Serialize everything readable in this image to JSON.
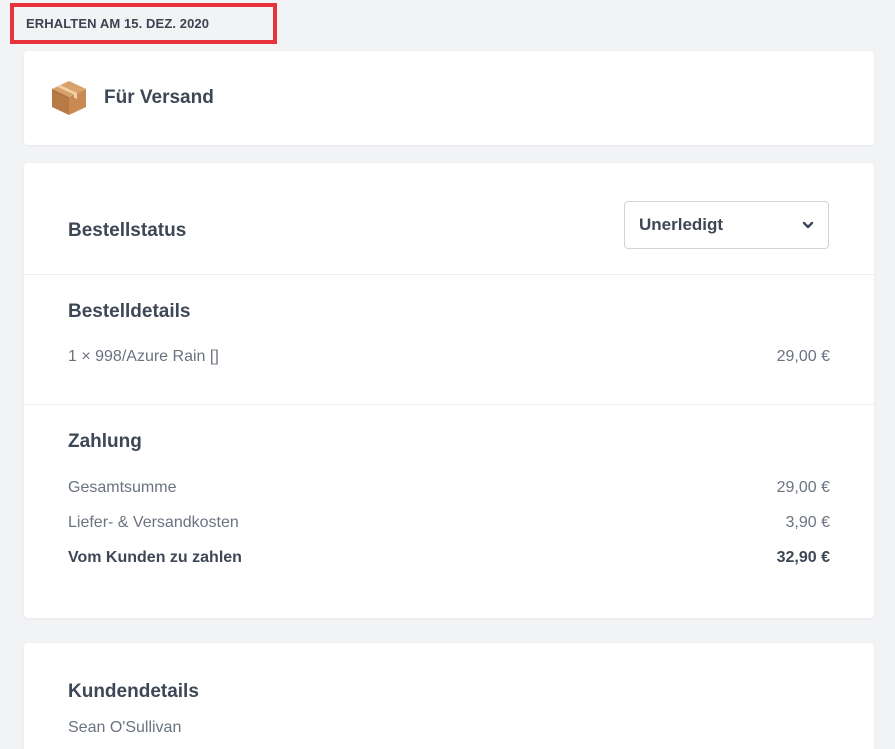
{
  "header": {
    "received_date": "ERHALTEN AM 15. DEZ. 2020"
  },
  "shipping": {
    "icon": "package-box-icon",
    "label": "Für Versand"
  },
  "order_status": {
    "title": "Bestellstatus",
    "selected": "Unerledigt",
    "chevron_icon": "chevron-down-icon"
  },
  "order_details": {
    "title": "Bestelldetails",
    "items": [
      {
        "description": "1 × 998/Azure Rain []",
        "price": "29,00 €"
      }
    ]
  },
  "payment": {
    "title": "Zahlung",
    "subtotal_label": "Gesamtsumme",
    "subtotal_value": "29,00 €",
    "shipping_label": "Liefer- & Versandkosten",
    "shipping_value": "3,90 €",
    "total_label": "Vom Kunden zu zahlen",
    "total_value": "32,90 €"
  },
  "customer": {
    "title": "Kundendetails",
    "name": "Sean O'Sullivan"
  },
  "colors": {
    "highlight_border": "#e8333a",
    "background": "#f2f3f5",
    "card": "#ffffff",
    "text_dark": "#3e4756",
    "text_muted": "#6b7380"
  }
}
